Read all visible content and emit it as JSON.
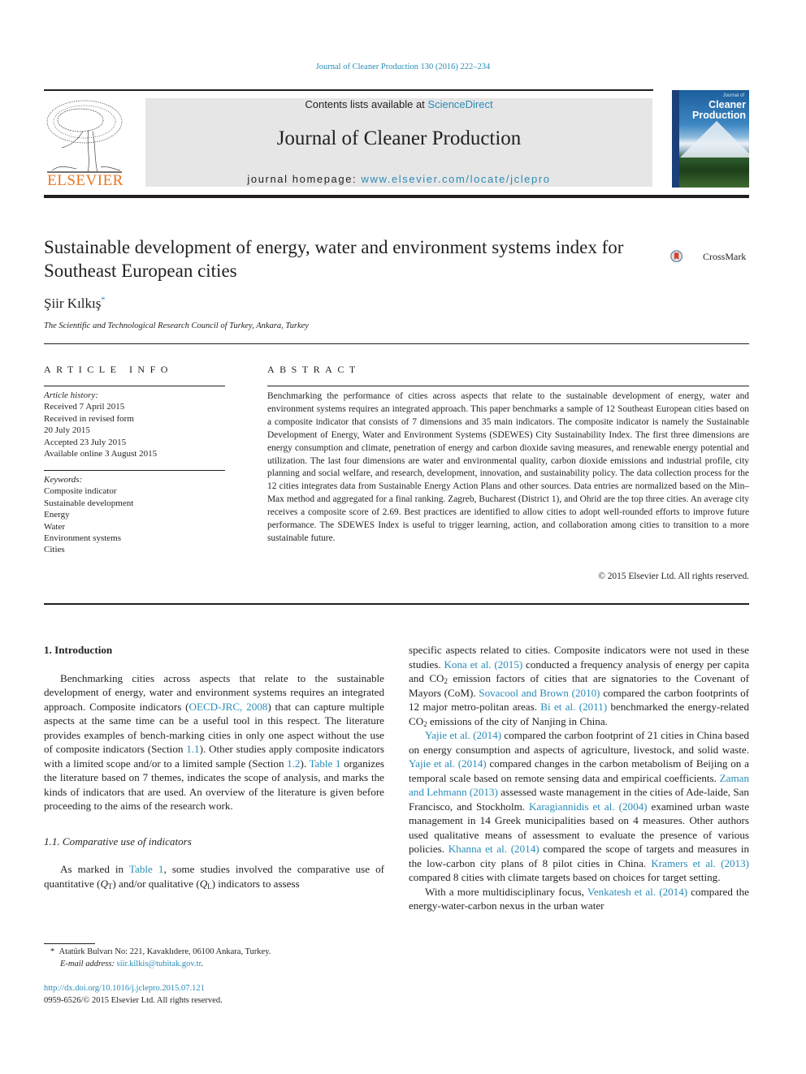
{
  "journal_ref": "Journal of Cleaner Production 130 (2016) 222–234",
  "masthead": {
    "contents_prefix": "Contents lists available at ",
    "contents_link": "ScienceDirect",
    "journal_title": "Journal of Cleaner Production",
    "homepage_prefix": "journal homepage: ",
    "homepage_url": "www.elsevier.com/locate/jclepro",
    "publisher_logo": "ELSEVIER",
    "cover": {
      "top_text": "Journal of",
      "title_line1": "Cleaner",
      "title_line2": "Production"
    }
  },
  "article": {
    "title": "Sustainable development of energy, water and environment systems index for Southeast European cities",
    "crossmark_label": "CrossMark",
    "author": "Şiir Kılkış",
    "author_mark": "*",
    "affiliation": "The Scientific and Technological Research Council of Turkey, Ankara, Turkey"
  },
  "article_info": {
    "heading": "ARTICLE INFO",
    "history_label": "Article history:",
    "history": [
      "Received 7 April 2015",
      "Received in revised form",
      "20 July 2015",
      "Accepted 23 July 2015",
      "Available online 3 August 2015"
    ],
    "keywords_label": "Keywords:",
    "keywords": [
      "Composite indicator",
      "Sustainable development",
      "Energy",
      "Water",
      "Environment systems",
      "Cities"
    ]
  },
  "abstract": {
    "heading": "ABSTRACT",
    "text": "Benchmarking the performance of cities across aspects that relate to the sustainable development of energy, water and environment systems requires an integrated approach. This paper benchmarks a sample of 12 Southeast European cities based on a composite indicator that consists of 7 dimensions and 35 main indicators. The composite indicator is namely the Sustainable Development of Energy, Water and Environment Systems (SDEWES) City Sustainability Index. The first three dimensions are energy consumption and climate, penetration of energy and carbon dioxide saving measures, and renewable energy potential and utilization. The last four dimensions are water and environmental quality, carbon dioxide emissions and industrial profile, city planning and social welfare, and research, development, innovation, and sustainability policy. The data collection process for the 12 cities integrates data from Sustainable Energy Action Plans and other sources. Data entries are normalized based on the Min–Max method and aggregated for a final ranking. Zagreb, Bucharest (District 1), and Ohrid are the top three cities. An average city receives a composite score of 2.69. Best practices are identified to allow cities to adopt well-rounded efforts to improve future performance. The SDEWES Index is useful to trigger learning, action, and collaboration among cities to transition to a more sustainable future.",
    "copyright": "© 2015 Elsevier Ltd. All rights reserved."
  },
  "body": {
    "section1_heading": "1.  Introduction",
    "p1": [
      {
        "t": "Benchmarking cities across aspects that relate to the sustainable development of energy, water and environment systems requires an integrated approach. Composite indicators ("
      },
      {
        "t": "OECD-JRC, 2008",
        "link": true
      },
      {
        "t": ") that can capture multiple aspects at the same time can be a useful tool in this respect. The literature provides examples of bench-marking cities in only one aspect without the use of composite indicators (Section "
      },
      {
        "t": "1.1",
        "link": true
      },
      {
        "t": "). Other studies apply composite indicators with a limited scope and/or to a limited sample (Section "
      },
      {
        "t": "1.2",
        "link": true
      },
      {
        "t": "). "
      },
      {
        "t": "Table 1",
        "link": true
      },
      {
        "t": " organizes the literature based on 7 themes, indicates the scope of analysis, and marks the kinds of indicators that are used. An overview of the literature is given before proceeding to the aims of the research work."
      }
    ],
    "subsection11_heading": "1.1.  Comparative use of indicators",
    "p2": [
      {
        "t": "As marked in "
      },
      {
        "t": "Table 1",
        "link": true
      },
      {
        "t": ", some studies involved the comparative use of quantitative ("
      },
      {
        "t": "Q",
        "italic": true
      },
      {
        "t": "T",
        "sub": true
      },
      {
        "t": ") and/or qualitative ("
      },
      {
        "t": "Q",
        "italic": true
      },
      {
        "t": "L",
        "sub": true
      },
      {
        "t": ") indicators to assess"
      }
    ],
    "p3": [
      {
        "t": "specific aspects related to cities. Composite indicators were not used in these studies. "
      },
      {
        "t": "Kona et al. (2015)",
        "link": true
      },
      {
        "t": " conducted a frequency analysis of energy per capita and CO"
      },
      {
        "t": "2",
        "sub": true
      },
      {
        "t": " emission factors of cities that are signatories to the Covenant of Mayors (CoM). "
      },
      {
        "t": "Sovacool and Brown (2010)",
        "link": true
      },
      {
        "t": " compared the carbon footprints of 12 major metro-politan areas. "
      },
      {
        "t": "Bi et al. (2011)",
        "link": true
      },
      {
        "t": " benchmarked the energy-related CO"
      },
      {
        "t": "2",
        "sub": true
      },
      {
        "t": " emissions of the city of Nanjing in China."
      }
    ],
    "p4": [
      {
        "t": "Yajie et al. (2014)",
        "link": true
      },
      {
        "t": " compared the carbon footprint of 21 cities in China based on energy consumption and aspects of agriculture, livestock, and solid waste. "
      },
      {
        "t": "Yajie et al. (2014)",
        "link": true
      },
      {
        "t": " compared changes in the carbon metabolism of Beijing on a temporal scale based on remote sensing data and empirical coefficients. "
      },
      {
        "t": "Zaman and Lehmann (2013)",
        "link": true
      },
      {
        "t": " assessed waste management in the cities of Ade-laide, San Francisco, and Stockholm. "
      },
      {
        "t": "Karagiannidis et al. (2004)",
        "link": true
      },
      {
        "t": " examined urban waste management in 14 Greek municipalities based on 4 measures. Other authors used qualitative means of assessment to evaluate the presence of various policies. "
      },
      {
        "t": "Khanna et al. (2014)",
        "link": true
      },
      {
        "t": " compared the scope of targets and measures in the low-carbon city plans of 8 pilot cities in China. "
      },
      {
        "t": "Kramers et al. (2013)",
        "link": true
      },
      {
        "t": " compared 8 cities with climate targets based on choices for target setting."
      }
    ],
    "p5": [
      {
        "t": "With a more multidisciplinary focus, "
      },
      {
        "t": "Venkatesh et al. (2014)",
        "link": true
      },
      {
        "t": " compared the energy-water-carbon nexus in the urban water"
      }
    ]
  },
  "footnote": {
    "mark": "*",
    "address": "Atatürk Bulvarı No: 221, Kavaklıdere, 06100 Ankara, Turkey.",
    "email_label": "E-mail address: ",
    "email": "siir.kilkis@tubitak.gov.tr",
    "email_suffix": "."
  },
  "doi": {
    "url": "http://dx.doi.org/10.1016/j.jclepro.2015.07.121",
    "issn_line": "0959-6526/© 2015 Elsevier Ltd. All rights reserved."
  },
  "colors": {
    "link": "#2a8cb8",
    "elsevier_orange": "#e87722",
    "masthead_bg": "#e6e6e6",
    "text": "#231f20"
  }
}
